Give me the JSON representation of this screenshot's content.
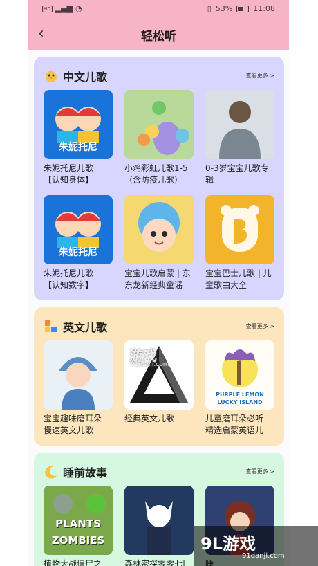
{
  "status": {
    "battery": "53%",
    "time": "11:08"
  },
  "nav": {
    "title": "轻松听"
  },
  "sections": [
    {
      "title": "中文儿歌",
      "more": "查看更多 >",
      "items": [
        {
          "line1": "朱妮托尼儿歌",
          "line2": "【认知身体】",
          "thumb_text": "朱妮托尼"
        },
        {
          "line1": "小鸡彩虹儿歌1-5",
          "line2": "（含防疫儿歌）"
        },
        {
          "line1": "0-3岁宝宝儿歌专",
          "line2": "辑"
        },
        {
          "line1": "朱妮托尼儿歌",
          "line2": "【认知数字】",
          "thumb_text": "朱妮托尼"
        },
        {
          "line1": "宝宝儿歌启蒙 | 东",
          "line2": "东龙新经典童谣"
        },
        {
          "line1": "宝宝巴士儿歌 | 儿",
          "line2": "童歌曲大全"
        }
      ]
    },
    {
      "title": "英文儿歌",
      "more": "查看更多 >",
      "items": [
        {
          "line1": "宝宝趣味磨耳朵",
          "line2": "慢速英文儿歌"
        },
        {
          "line1": "经典英文儿歌",
          "line2": ""
        },
        {
          "line1": "儿童磨耳朵必听",
          "line2": "精选启蒙英语儿",
          "thumb_text1": "PURPLE LEMON",
          "thumb_text2": "LUCKY ISLAND"
        }
      ]
    },
    {
      "title": "睡前故事",
      "more": "查看更多 >",
      "items": [
        {
          "line1": "植物大战僵尸之",
          "line2": "",
          "thumb_text1": "PLANTS",
          "thumb_text2": "ZOMBIES"
        },
        {
          "line1": "森林密探零零七|",
          "line2": ""
        },
        {
          "line1": "睡",
          "line2": ""
        }
      ]
    }
  ],
  "watermark": {
    "big": "9L游戏",
    "small": "91danji.com",
    "mid": "游戏",
    "mid_small": "91danji.com"
  }
}
